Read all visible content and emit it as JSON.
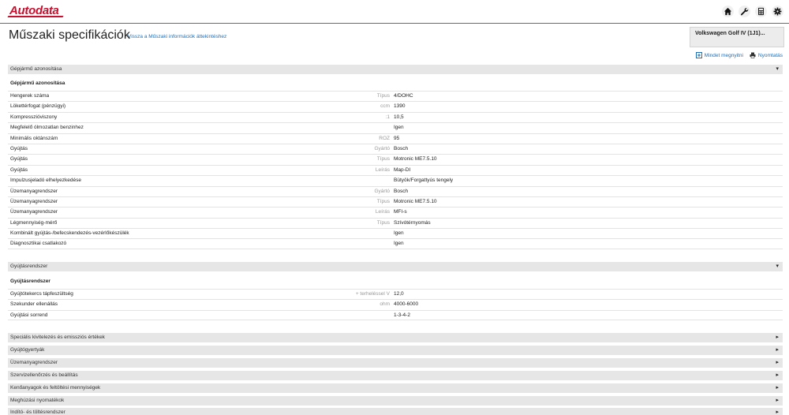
{
  "header": {
    "logo_text": "Autodata",
    "icons": [
      "home-icon",
      "wrench-icon",
      "calculator-icon",
      "gear-icon"
    ]
  },
  "page": {
    "title": "Műszaki specifikációk",
    "back_link": "Vissza a Műszaki információk áttekintéshez",
    "vehicle": "Volkswagen Golf IV (1J1)...",
    "show_all": "Mindet megnyitni",
    "print": "Nyomtatás"
  },
  "sections": {
    "engine_id": {
      "bar": "Gépjármű azonosítása",
      "subheading": "Gépjármű azonosítása",
      "rows": [
        {
          "name": "Hengerek száma",
          "unit": "Típus",
          "value": "4/DOHC"
        },
        {
          "name": "Lökettérfogat (pénzügyi)",
          "unit": "ccm",
          "value": "1390"
        },
        {
          "name": "Kompresszióviszony",
          "unit": ":1",
          "value": "10,5"
        },
        {
          "name": "Megfelelő ólmozatlan benzinhez",
          "unit": "",
          "value": "Igen"
        },
        {
          "name": "Minimális oktánszám",
          "unit": "ROZ",
          "value": "95"
        },
        {
          "name": "Gyújtás",
          "unit": "Gyártó",
          "value": "Bosch"
        },
        {
          "name": "Gyújtás",
          "unit": "Típus",
          "value": "Motronic ME7.5.10"
        },
        {
          "name": "Gyújtás",
          "unit": "Leírás",
          "value": "Map-DI"
        },
        {
          "name": "Impulzusjeladó elhelyezkedése",
          "unit": "",
          "value": "Bütyök/Forgattyús tengely"
        },
        {
          "name": "Üzemanyagrendszer",
          "unit": "Gyártó",
          "value": "Bosch"
        },
        {
          "name": "Üzemanyagrendszer",
          "unit": "Típus",
          "value": "Motronic ME7.5.10"
        },
        {
          "name": "Üzemanyagrendszer",
          "unit": "Leírás",
          "value": "MFI-s"
        },
        {
          "name": "Légmennyiség-mérő",
          "unit": "Típus",
          "value": "Szívótérnyomás"
        },
        {
          "name": "Kombinált gyújtás-/befecskendezés-vezérlőkészülék",
          "unit": "",
          "value": "Igen"
        },
        {
          "name": "Diagnosztikai csatlakozó",
          "unit": "",
          "value": "Igen"
        }
      ]
    },
    "ignition": {
      "bar": "Gyújtásrendszer",
      "subheading": "Gyújtásrendszer",
      "rows": [
        {
          "name": "Gyújtótekercs tápfeszültség",
          "unit": "+ terheléssel V",
          "value": "12,0"
        },
        {
          "name": "Szekunder ellenállás",
          "unit": "ohm",
          "value": "4000-6000"
        },
        {
          "name": "Gyújtási sorrend",
          "unit": "",
          "value": "1-3-4-2"
        }
      ]
    },
    "collapsed": [
      "Speciális kivitelezés és emissziós értékek",
      "Gyújtógyertyák",
      "Üzemanyagrendszer",
      "Szervizellenőrzés és beállítás",
      "Kenőanyagok és feltöltési mennyiségek",
      "Meghúzási nyomatékok",
      "Indító- és töltésrendszer"
    ]
  },
  "colors": {
    "brand": "#c8102e",
    "link": "#1f6fb8",
    "section_bar": "#e6e6e6"
  }
}
